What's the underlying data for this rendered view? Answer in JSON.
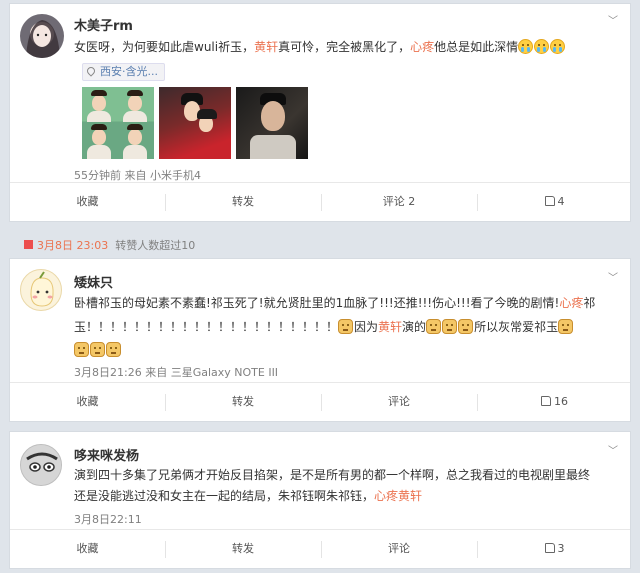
{
  "post1": {
    "username": "木美子rm",
    "text_parts": [
      "女医呀，为何要如此虐wuli祈玉，",
      "黄轩",
      "真可怜，完全被黑化了，",
      "心疼",
      "他总是如此深情"
    ],
    "emojis": [
      "cry-emoji",
      "cry-emoji",
      "cry-emoji"
    ],
    "location": "西安·含光...",
    "meta": "55分钟前 来自 小米手机4",
    "actions": {
      "collect": "收藏",
      "repost": "转发",
      "comment": "评论 2",
      "like": "4"
    }
  },
  "repost_bar": {
    "date": "3月8日 23:03",
    "text": "转赞人数超过10"
  },
  "post2": {
    "username": "矮妹只",
    "line1_parts": [
      "卧槽祁玉的母妃素不素蠢!祁玉死了!就允贤肚里的1血脉了!!!还推!!!伤心!!!看了今晚的剧情!",
      "心疼",
      "祁"
    ],
    "line2_parts": [
      "玉！！！！！！！！！！！！！！！！！！！！！",
      "因为",
      "黄轩",
      "演的",
      "所以灰常爱祁玉"
    ],
    "meta": "3月8日21:26 来自 三星Galaxy NOTE III",
    "actions": {
      "collect": "收藏",
      "repost": "转发",
      "comment": "评论",
      "like": "16"
    }
  },
  "post3": {
    "username": "哆来咪发杨",
    "line1": "演到四十多集了兄弟俩才开始反目掐架，是不是所有男的都一个样啊，总之我看过的电视剧里最终",
    "line2_parts": [
      "还是没能逃过没和女主在一起的结局，朱祁钰啊朱祁钰，",
      "心疼黄轩"
    ],
    "meta": "3月8日22:11",
    "actions": {
      "collect": "收藏",
      "repost": "转发",
      "comment": "评论",
      "like": "3"
    }
  },
  "colors": {
    "highlight": "#eb7350",
    "meta": "#808080",
    "background": "#dfe4ea"
  }
}
